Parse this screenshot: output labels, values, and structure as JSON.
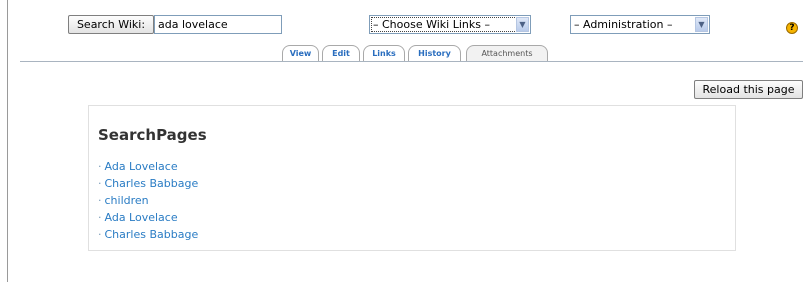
{
  "search": {
    "button_label": "Search Wiki:",
    "input_value": "ada lovelace"
  },
  "wiki_links_select": {
    "selected": "– Choose Wiki Links –"
  },
  "admin_select": {
    "selected": "– Administration –"
  },
  "help_icon": {
    "glyph": "?",
    "icon": "help-icon",
    "color": "#f6b400"
  },
  "tabs": [
    {
      "label": "View"
    },
    {
      "label": "Edit"
    },
    {
      "label": "Links"
    },
    {
      "label": "History"
    },
    {
      "label": "Attachments",
      "active": true
    }
  ],
  "reload_button": {
    "label": "Reload this page"
  },
  "main": {
    "title": "SearchPages",
    "results": [
      {
        "bullet": "·",
        "label": "Ada Lovelace"
      },
      {
        "bullet": "·",
        "label": "Charles Babbage"
      },
      {
        "bullet": "·",
        "label": "children"
      },
      {
        "bullet": "·",
        "label": "Ada Lovelace"
      },
      {
        "bullet": "·",
        "label": "Charles Babbage"
      }
    ]
  },
  "colors": {
    "link": "#2a7cc4",
    "tab_link": "#2a6ebf",
    "select_border": "#7f9db9"
  }
}
